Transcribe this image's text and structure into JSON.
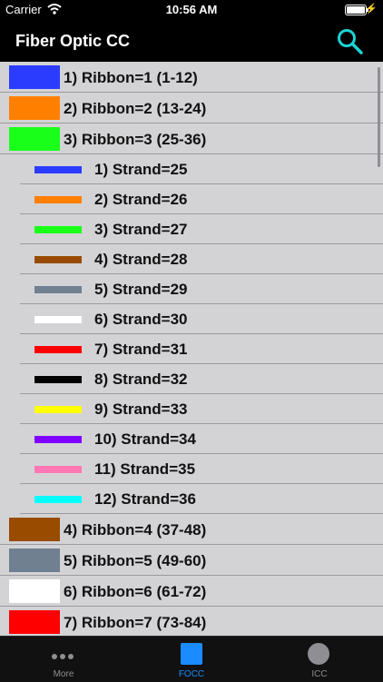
{
  "status_bar": {
    "carrier": "Carrier",
    "time": "10:56 AM"
  },
  "header": {
    "title": "Fiber Optic CC",
    "search_icon": "search-icon"
  },
  "ribbons_before": [
    {
      "label": "1) Ribbon=1 (1-12)",
      "color": "#2b3cff"
    },
    {
      "label": "2) Ribbon=2 (13-24)",
      "color": "#ff7f00"
    },
    {
      "label": "3) Ribbon=3 (25-36)",
      "color": "#19ff19"
    }
  ],
  "strands": [
    {
      "label": "1) Strand=25",
      "color": "#2b3cff"
    },
    {
      "label": "2) Strand=26",
      "color": "#ff7f00"
    },
    {
      "label": "3) Strand=27",
      "color": "#19ff19"
    },
    {
      "label": "4) Strand=28",
      "color": "#994c00"
    },
    {
      "label": "5) Strand=29",
      "color": "#708090"
    },
    {
      "label": "6) Strand=30",
      "color": "#ffffff"
    },
    {
      "label": "7) Strand=31",
      "color": "#ff0000"
    },
    {
      "label": "8) Strand=32",
      "color": "#000000"
    },
    {
      "label": "9) Strand=33",
      "color": "#ffff00"
    },
    {
      "label": "10) Strand=34",
      "color": "#8000ff"
    },
    {
      "label": "11) Strand=35",
      "color": "#ff77b4"
    },
    {
      "label": "12) Strand=36",
      "color": "#00ffff"
    }
  ],
  "ribbons_after": [
    {
      "label": "4) Ribbon=4 (37-48)",
      "color": "#994c00"
    },
    {
      "label": "5) Ribbon=5 (49-60)",
      "color": "#708090"
    },
    {
      "label": "6) Ribbon=6 (61-72)",
      "color": "#ffffff"
    },
    {
      "label": "7) Ribbon=7 (73-84)",
      "color": "#ff0000"
    }
  ],
  "tabs": [
    {
      "label": "More",
      "icon": "more-dots-icon",
      "active": false
    },
    {
      "label": "FOCC",
      "icon": "square-icon",
      "active": true
    },
    {
      "label": "ICC",
      "icon": "circle-icon",
      "active": false
    }
  ]
}
